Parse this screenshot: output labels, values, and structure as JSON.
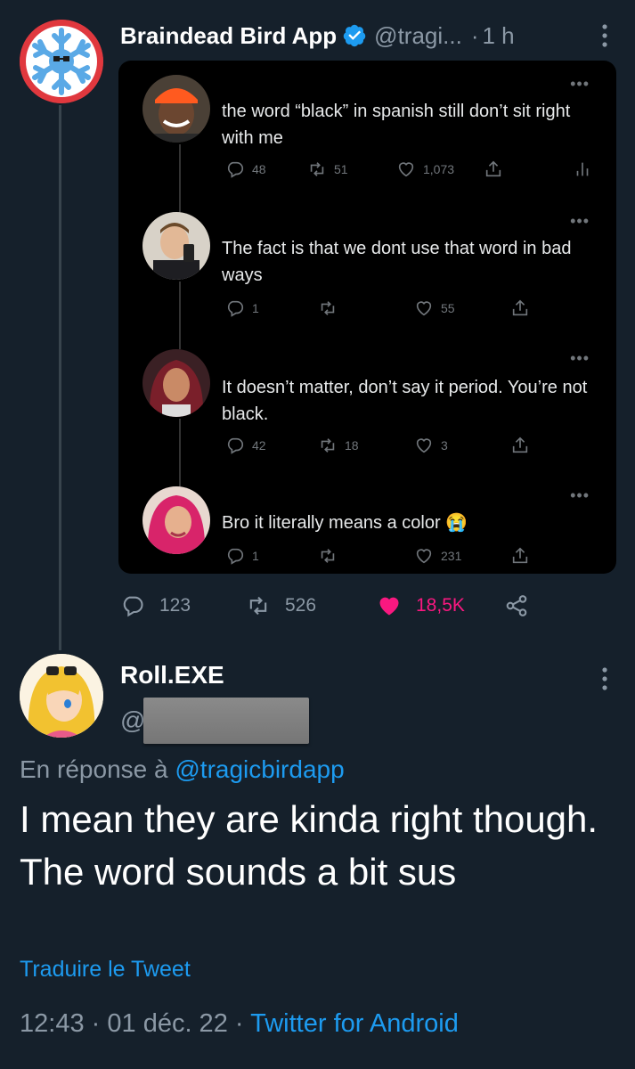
{
  "parent": {
    "name": "Braindead Bird App",
    "handle": "@tragi...",
    "separator": "·",
    "time": "1 h",
    "actions": {
      "replies": "123",
      "retweets": "526",
      "likes": "18,5K"
    }
  },
  "embedded_thread": [
    {
      "text": "the word “black” in spanish still don’t sit right with me",
      "replies": "48",
      "retweets": "51",
      "likes": "1,073"
    },
    {
      "text": "The fact is that we dont use that word in bad ways",
      "replies": "1",
      "retweets": "",
      "likes": "55"
    },
    {
      "text": "It doesn’t matter, don’t say it period. You’re not black.",
      "replies": "42",
      "retweets": "18",
      "likes": "3"
    },
    {
      "text": "Bro it literally means a color 😭",
      "replies": "1",
      "retweets": "",
      "likes": "231"
    }
  ],
  "reply": {
    "name": "Roll.EXE",
    "handle_prefix": "@",
    "in_reply_to_label": "En réponse à",
    "in_reply_to_handle": "@tragicbirdapp",
    "body": "I mean they are kinda right though. The word sounds a bit sus",
    "translate_label": "Traduire le Tweet",
    "time": "12:43",
    "date": "01 déc. 22",
    "separator": "·",
    "client": "Twitter for Android"
  },
  "colors": {
    "background": "#15202b",
    "accent_blue": "#1d9bf0",
    "like_pink": "#f91880",
    "muted": "#8b98a5"
  },
  "icons": [
    "verified-badge-icon",
    "more-vertical-icon",
    "reply-icon",
    "retweet-icon",
    "heart-icon",
    "share-icon",
    "analytics-icon"
  ]
}
